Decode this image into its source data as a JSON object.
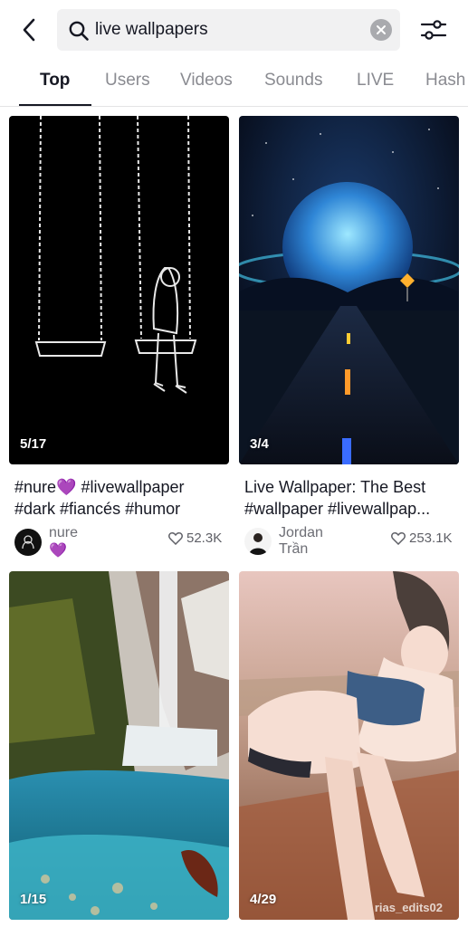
{
  "search": {
    "query": "live wallpapers"
  },
  "tabs": [
    {
      "label": "Top"
    },
    {
      "label": "Users"
    },
    {
      "label": "Videos"
    },
    {
      "label": "Sounds"
    },
    {
      "label": "LIVE"
    },
    {
      "label": "Hash"
    }
  ],
  "results": [
    {
      "count": "5/17",
      "caption_line1": "#nure💜 #livewallpaper",
      "caption_line2": "#dark #fiancés #humor",
      "author": "nure💜",
      "likes": "52.3K"
    },
    {
      "count": "3/4",
      "caption_line1": "Live Wallpaper: The Best",
      "caption_line2": "#wallpaper #livewallpap...",
      "author": "Jordan Trần",
      "likes": "253.1K"
    },
    {
      "count": "1/15"
    },
    {
      "count": "4/29",
      "watermark": "rias_edits02"
    }
  ],
  "colors": {
    "text": "#161823",
    "muted": "#8a8b91",
    "search_bg": "#f1f1f2"
  }
}
